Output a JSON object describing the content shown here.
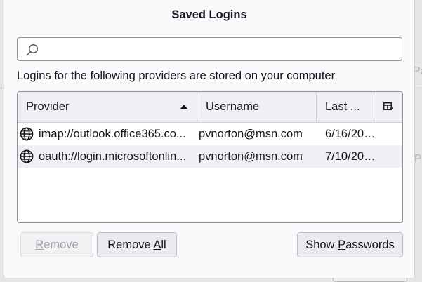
{
  "dialog": {
    "title": "Saved Logins",
    "search": {
      "value": "",
      "placeholder": ""
    },
    "description": "Logins for the following providers are stored on your computer"
  },
  "table": {
    "columns": {
      "provider": "Provider",
      "username": "Username",
      "last_changed": "Last ..."
    },
    "sort": {
      "column": "provider",
      "direction": "ascending"
    },
    "rows": [
      {
        "provider": "imap://outlook.office365.co...",
        "username": "pvnorton@msn.com",
        "last_changed": "6/16/202..."
      },
      {
        "provider": "oauth://login.microsoftonlin...",
        "username": "pvnorton@msn.com",
        "last_changed": "7/10/202..."
      }
    ]
  },
  "buttons": {
    "remove": {
      "label_underlined": "R",
      "label_rest": "emove",
      "enabled": false
    },
    "remove_all": {
      "label_start": "Remove ",
      "label_underlined": "A",
      "label_rest": "ll",
      "enabled": true
    },
    "show_passwords": {
      "label_start": "Show ",
      "label_underlined": "P",
      "label_rest": "asswords",
      "enabled": true
    }
  },
  "icons": {
    "search": "search-icon",
    "sort": "sort-ascending-icon",
    "column_picker": "column-picker-icon",
    "row": "globe-icon"
  },
  "colors": {
    "dialog_bg": "#f9f9fb",
    "header_bg": "#f0f0f4",
    "border": "#8f8f9d",
    "text": "#15141a"
  }
}
